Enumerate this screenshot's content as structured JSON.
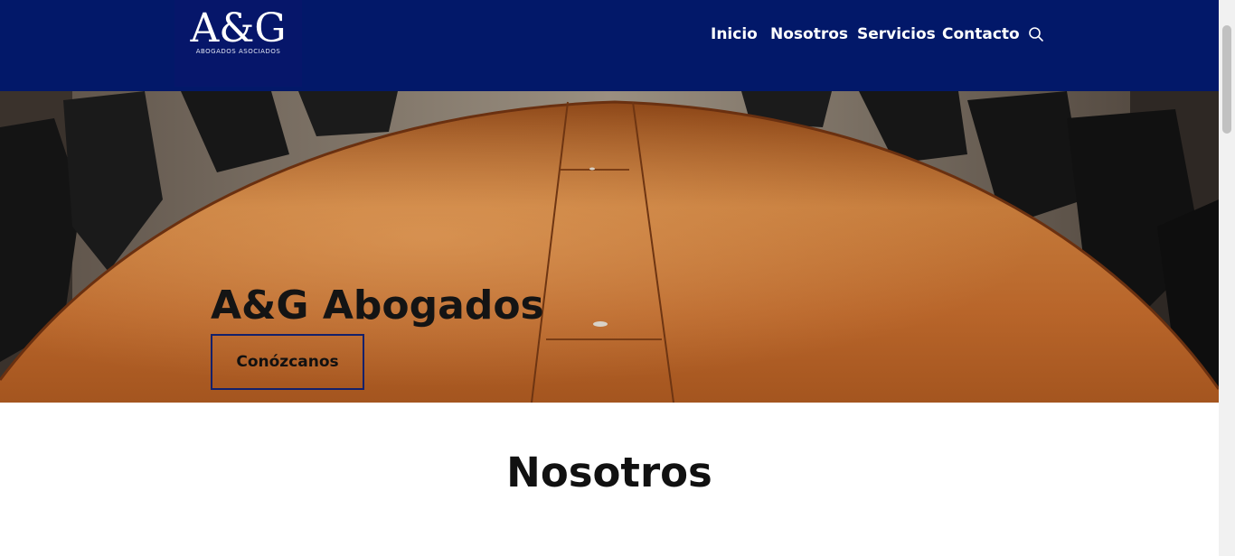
{
  "logo": {
    "main": "A&G",
    "sub": "ABOGADOS ASOCIADOS"
  },
  "nav": {
    "items": [
      {
        "label": "Inicio"
      },
      {
        "label": "Nosotros"
      },
      {
        "label": "Servicios"
      },
      {
        "label": "Contacto"
      }
    ],
    "search_icon": "search-icon"
  },
  "hero": {
    "title": "A&G Abogados",
    "button_label": "Conózcanos"
  },
  "section": {
    "title": "Nosotros"
  },
  "colors": {
    "header": "#021869",
    "button_border": "#13206b",
    "table": "#b5652a"
  }
}
